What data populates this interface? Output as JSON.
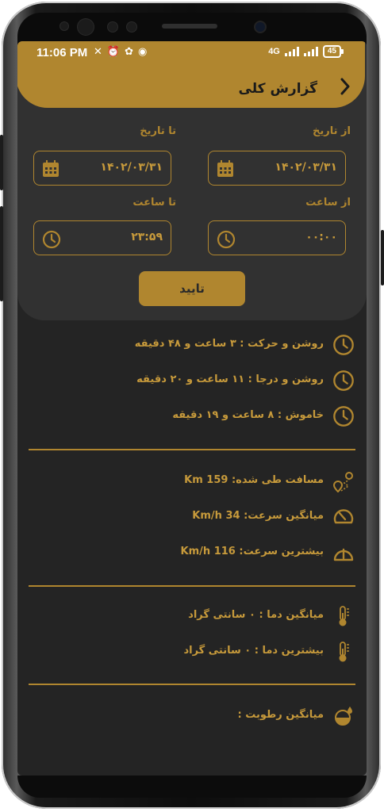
{
  "status_bar": {
    "time": "11:06 PM",
    "network": "4G",
    "battery": "45"
  },
  "header": {
    "title": "گزارش کلی",
    "back_icon": "chevron-right-icon"
  },
  "filter": {
    "from_date_label": "از تاریخ",
    "from_date_value": "۱۴۰۲/۰۳/۳۱",
    "to_date_label": "تا تاریخ",
    "to_date_value": "۱۴۰۲/۰۳/۳۱",
    "from_time_label": "از ساعت",
    "from_time_value": "۰۰:۰۰",
    "to_time_label": "تا ساعت",
    "to_time_value": "۲۳:۵۹",
    "confirm_label": "تایید"
  },
  "stats": {
    "engine": [
      {
        "icon": "clock-icon",
        "text": "روشن و حرکت : ۳ ساعت و ۴۸ دقیقه"
      },
      {
        "icon": "clock-icon",
        "text": "روشن و درجا : ۱۱ ساعت و ۲۰ دقیقه"
      },
      {
        "icon": "clock-icon",
        "text": "خاموش : ۸ ساعت و ۱۹ دقیقه"
      }
    ],
    "movement": [
      {
        "icon": "route-icon",
        "text": "مسافت طی شده: 159 Km"
      },
      {
        "icon": "speedometer-icon",
        "text": "میانگین سرعت: 34 Km/h"
      },
      {
        "icon": "max-speed-icon",
        "text": "بیشترین سرعت: 116 Km/h"
      }
    ],
    "temperature": [
      {
        "icon": "thermometer-icon",
        "text": "میانگین دما : ۰ سانتی گراد"
      },
      {
        "icon": "thermometer-icon",
        "text": "بیشترین دما : ۰ سانتی گراد"
      }
    ],
    "humidity": [
      {
        "icon": "humidity-icon",
        "text": "میانگین رطوبت :"
      }
    ]
  },
  "colors": {
    "accent": "#b0862f",
    "background": "#242424",
    "card": "#313131"
  }
}
